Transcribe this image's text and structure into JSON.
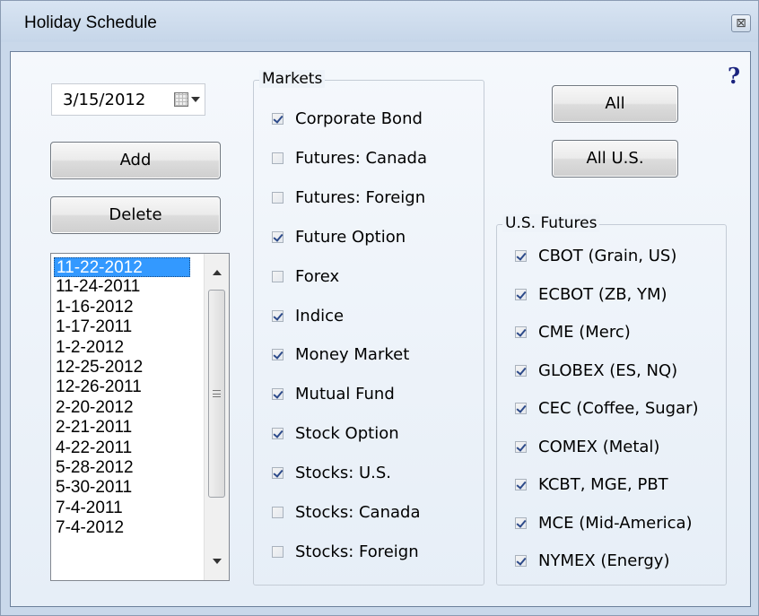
{
  "window": {
    "title": "Holiday Schedule",
    "close_glyph": "⊠",
    "help_glyph": "?"
  },
  "date_picker": {
    "value": "3/15/2012",
    "icon": "calendar-dropdown-icon"
  },
  "buttons": {
    "add": "Add",
    "delete": "Delete",
    "all": "All",
    "all_us": "All U.S."
  },
  "holiday_list": {
    "items": [
      "11-22-2012",
      "11-24-2011",
      "1-16-2012",
      "1-17-2011",
      "1-2-2012",
      "12-25-2012",
      "12-26-2011",
      "2-20-2012",
      "2-21-2011",
      "4-22-2011",
      "5-28-2012",
      "5-30-2011",
      "7-4-2011",
      "7-4-2012"
    ],
    "selected": "11-22-2012"
  },
  "markets": {
    "legend": "Markets",
    "items": [
      {
        "label": "Corporate Bond",
        "checked": true
      },
      {
        "label": "Futures:  Canada",
        "checked": false
      },
      {
        "label": "Futures:  Foreign",
        "checked": false
      },
      {
        "label": "Future Option",
        "checked": true
      },
      {
        "label": "Forex",
        "checked": false
      },
      {
        "label": "Indice",
        "checked": true
      },
      {
        "label": "Money Market",
        "checked": true
      },
      {
        "label": "Mutual Fund",
        "checked": true
      },
      {
        "label": "Stock Option",
        "checked": true
      },
      {
        "label": "Stocks:  U.S.",
        "checked": true
      },
      {
        "label": "Stocks:  Canada",
        "checked": false
      },
      {
        "label": "Stocks:  Foreign",
        "checked": false
      }
    ]
  },
  "us_futures": {
    "legend": "U.S. Futures",
    "items": [
      {
        "label": "CBOT  (Grain, US)",
        "checked": true
      },
      {
        "label": "ECBOT  (ZB, YM)",
        "checked": true
      },
      {
        "label": "CME  (Merc)",
        "checked": true
      },
      {
        "label": "GLOBEX  (ES, NQ)",
        "checked": true
      },
      {
        "label": "CEC  (Coffee, Sugar)",
        "checked": true
      },
      {
        "label": "COMEX  (Metal)",
        "checked": true
      },
      {
        "label": "KCBT, MGE, PBT",
        "checked": true
      },
      {
        "label": "MCE  (Mid-America)",
        "checked": true
      },
      {
        "label": "NYMEX  (Energy)",
        "checked": true
      }
    ]
  }
}
